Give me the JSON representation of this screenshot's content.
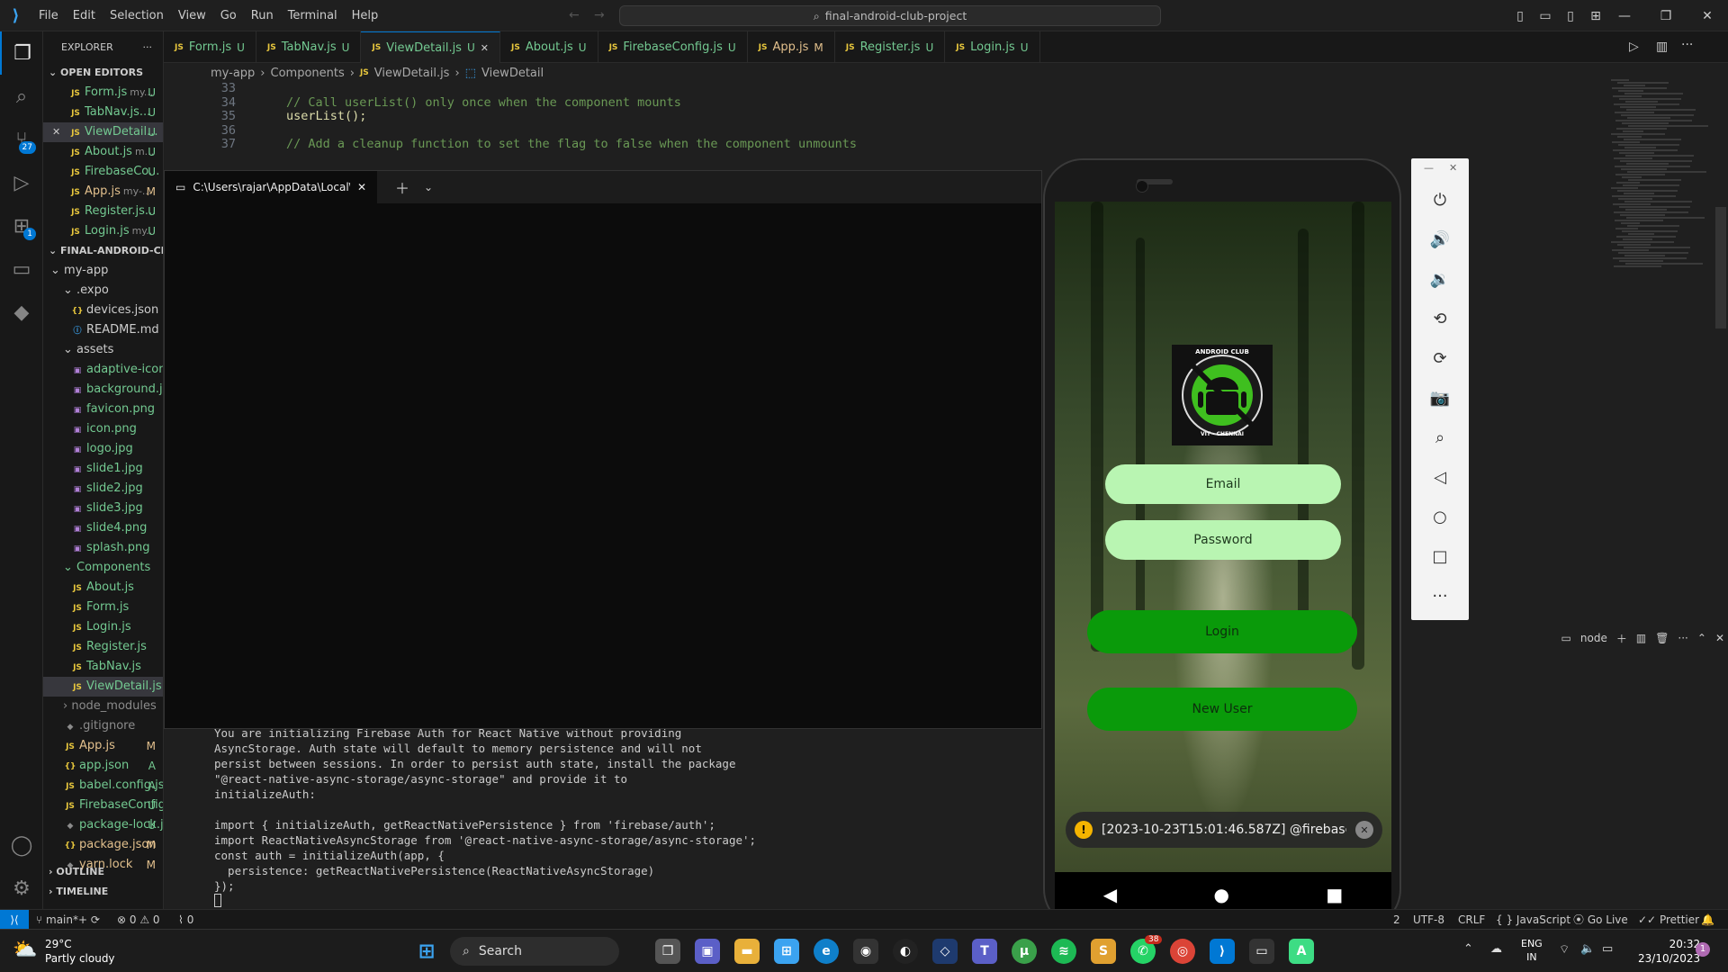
{
  "titlebar": {
    "menu": [
      "File",
      "Edit",
      "Selection",
      "View",
      "Go",
      "Run",
      "Terminal",
      "Help"
    ],
    "command_center": "final-android-club-project"
  },
  "activity": {
    "scm_badge": "27",
    "ext_badge": "1"
  },
  "explorer": {
    "title": "EXPLORER",
    "open_editors_title": "OPEN EDITORS",
    "open_editors": [
      {
        "name": "Form.js",
        "hint": "my...",
        "status": "U"
      },
      {
        "name": "TabNav.js...",
        "hint": "",
        "status": "U"
      },
      {
        "name": "ViewDetail...",
        "hint": "",
        "status": "U"
      },
      {
        "name": "About.js",
        "hint": "m...",
        "status": "U"
      },
      {
        "name": "FirebaseCo...",
        "hint": "",
        "status": "U"
      },
      {
        "name": "App.js",
        "hint": "my-...",
        "status": "M"
      },
      {
        "name": "Register.js...",
        "hint": "",
        "status": "U"
      },
      {
        "name": "Login.js",
        "hint": "my...",
        "status": "U"
      }
    ],
    "project_title": "FINAL-ANDROID-CLUB...",
    "tree": {
      "my_app": "my-app",
      "expo": ".expo",
      "devices": "devices.json",
      "readme": "README.md",
      "assets": "assets",
      "asset_files": [
        "adaptive-icon...",
        "background.j...",
        "favicon.png",
        "icon.png",
        "logo.jpg",
        "slide1.jpg",
        "slide2.jpg",
        "slide3.jpg",
        "slide4.png",
        "splash.png"
      ],
      "components": "Components",
      "component_files": [
        "About.js",
        "Form.js",
        "Login.js",
        "Register.js",
        "TabNav.js",
        "ViewDetail.js"
      ],
      "node_modules": "node_modules",
      "root_files": [
        {
          "name": ".gitignore",
          "status": ""
        },
        {
          "name": "App.js",
          "status": "M"
        },
        {
          "name": "app.json",
          "status": "A"
        },
        {
          "name": "babel.config.js",
          "status": "A"
        },
        {
          "name": "FirebaseConfig.js",
          "status": "U"
        },
        {
          "name": "package-lock.js...",
          "status": "U"
        },
        {
          "name": "package.json",
          "status": "M"
        },
        {
          "name": "yarn.lock",
          "status": "M"
        }
      ]
    },
    "outline": "OUTLINE",
    "timeline": "TIMELINE"
  },
  "tabs": [
    {
      "label": "Form.js",
      "status": "U"
    },
    {
      "label": "TabNav.js",
      "status": "U"
    },
    {
      "label": "ViewDetail.js",
      "status": "U"
    },
    {
      "label": "About.js",
      "status": "U"
    },
    {
      "label": "FirebaseConfig.js",
      "status": "U"
    },
    {
      "label": "App.js",
      "status": "M"
    },
    {
      "label": "Register.js",
      "status": "U"
    },
    {
      "label": "Login.js",
      "status": "U"
    }
  ],
  "breadcrumb": [
    "my-app",
    "Components",
    "ViewDetail.js",
    "ViewDetail"
  ],
  "code_lines": [
    {
      "n": "33",
      "text": ""
    },
    {
      "n": "34",
      "text": "// Call userList() only once when the component mounts"
    },
    {
      "n": "35",
      "text": "userList();"
    },
    {
      "n": "36",
      "text": ""
    },
    {
      "n": "37",
      "text": "// Add a cleanup function to set the flag to false when the component unmounts"
    }
  ],
  "terminal_window": {
    "tab_title": "C:\\Users\\rajar\\AppData\\Local\\"
  },
  "panel": {
    "shell": "node",
    "lines": [
      "You are initializing Firebase Auth for React Native without providing",
      "AsyncStorage. Auth state will default to memory persistence and will not",
      "persist between sessions. In order to persist auth state, install the package",
      "\"@react-native-async-storage/async-storage\" and provide it to",
      "initializeAuth:",
      "",
      "import { initializeAuth, getReactNativePersistence } from 'firebase/auth';",
      "import ReactNativeAsyncStorage from '@react-native-async-storage/async-storage';",
      "const auth = initializeAuth(app, {",
      "  persistence: getReactNativePersistence(ReactNativeAsyncStorage)",
      "});"
    ]
  },
  "phone": {
    "logo_text_top": "ANDROID CLUB",
    "logo_text_bottom": "VIT - CHENNAI",
    "email_placeholder": "Email",
    "password_placeholder": "Password",
    "login": "Login",
    "new_user": "New User",
    "toast": "[2023-10-23T15:01:46.587Z] @firebase/aut..."
  },
  "statusbar": {
    "branch": "main*+",
    "errors": "0",
    "warnings": "0",
    "ports": "0",
    "col": "2",
    "encoding": "UTF-8",
    "eol": "CRLF",
    "language": "JavaScript",
    "golive": "Go Live",
    "prettier": "Prettier"
  },
  "taskbar": {
    "temp": "29°C",
    "weather": "Partly cloudy",
    "search": "Search",
    "lang1": "ENG",
    "lang2": "IN",
    "time": "20:32",
    "date": "23/10/2023",
    "notif": "1",
    "whatsapp_badge": "38"
  },
  "colors": {
    "accent": "#0078d4",
    "untracked": "#73c991",
    "modified": "#e2c08d",
    "login_button": "#0a9a0a",
    "input_bg": "#b9f5b2"
  }
}
